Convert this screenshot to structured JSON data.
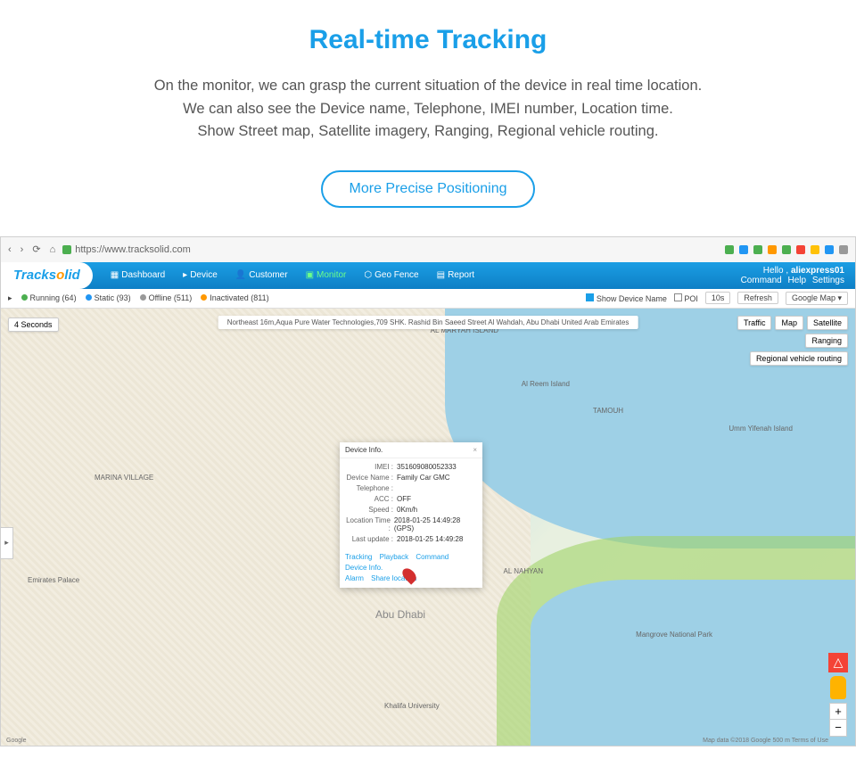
{
  "promo": {
    "title": "Real-time Tracking",
    "line1": "On the monitor, we can grasp the current situation of the device in real time location.",
    "line2": "We can also see the Device name, Telephone, IMEI number, Location time.",
    "line3": "Show Street map, Satellite imagery, Ranging, Regional vehicle routing.",
    "button": "More Precise Positioning"
  },
  "browser": {
    "url": "https://www.tracksolid.com"
  },
  "header": {
    "logo_main": "Tracks",
    "logo_accent": "lid",
    "nav": [
      {
        "label": "Dashboard"
      },
      {
        "label": "Device"
      },
      {
        "label": "Customer"
      },
      {
        "label": "Monitor",
        "active": true
      },
      {
        "label": "Geo Fence"
      },
      {
        "label": "Report"
      }
    ],
    "hello": "Hello ,",
    "user": "aliexpress01",
    "links": [
      "Command",
      "Help",
      "Settings"
    ]
  },
  "status": {
    "items": [
      {
        "color": "sd-green",
        "label": "Running (64)"
      },
      {
        "color": "sd-blue",
        "label": "Static (93)"
      },
      {
        "color": "sd-gray",
        "label": "Offline (511)"
      },
      {
        "color": "sd-orange",
        "label": "Inactivated (811)"
      }
    ],
    "show_device_name": "Show Device Name",
    "poi": "POI",
    "interval": "10s",
    "refresh": "Refresh",
    "map_select": "Google Map"
  },
  "map": {
    "seconds": "4 Seconds",
    "address": "Northeast 16m,Aqua Pure Water Technologies,709 SHK. Rashid Bin Saeed Street Al Wahdah, Abu Dhabi United Arab Emirates",
    "traffic": "Traffic",
    "maptype": {
      "map": "Map",
      "satellite": "Satellite"
    },
    "ranging": "Ranging",
    "regional": "Regional vehicle routing",
    "attrib_left": "Google",
    "attrib_right": "Map data ©2018 Google   500 m   Terms of Use",
    "labels": {
      "abudhabi": "Abu Dhabi",
      "alreem": "Al Reem Island",
      "mangrove": "Mangrove National Park",
      "marina": "MARINA VILLAGE",
      "emirates": "Emirates Palace",
      "khalifa": "Khalifa University",
      "nahyan": "AL NAHYAN",
      "tamouh": "TAMOUH",
      "maryah": "AL MARYAH ISLAND",
      "yifenah": "Umm Yifenah Island"
    }
  },
  "device_popup": {
    "title": "Device Info.",
    "rows": [
      {
        "label": "IMEI :",
        "value": "351609080052333"
      },
      {
        "label": "Device Name :",
        "value": "Family Car GMC"
      },
      {
        "label": "Telephone :",
        "value": ""
      },
      {
        "label": "ACC :",
        "value": "OFF"
      },
      {
        "label": "Speed :",
        "value": "0Km/h"
      },
      {
        "label": "Location Time :",
        "value": "2018-01-25 14:49:28 (GPS)"
      },
      {
        "label": "Last update :",
        "value": "2018-01-25 14:49:28"
      }
    ],
    "links1": [
      "Tracking",
      "Playback",
      "Command",
      "Device Info."
    ],
    "links2": [
      "Alarm",
      "Share location"
    ]
  }
}
